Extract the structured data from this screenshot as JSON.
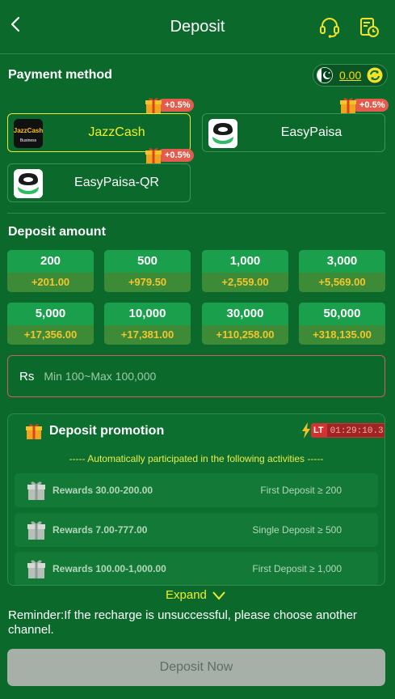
{
  "header": {
    "title": "Deposit",
    "back_icon": "chevron-left-icon",
    "support_icon": "headset-icon",
    "history_icon": "history-icon"
  },
  "payment": {
    "title": "Payment method",
    "balance": "0.00",
    "methods": [
      {
        "name": "JazzCash",
        "bonus": "+0.5%",
        "logo_text": "JazzCash",
        "logo_sub": "Business"
      },
      {
        "name": "EasyPaisa",
        "bonus": "+0.5%"
      },
      {
        "name": "EasyPaisa-QR",
        "bonus": "+0.5%"
      }
    ]
  },
  "deposit": {
    "title": "Deposit amount",
    "options": [
      {
        "amount": "200",
        "bonus": "+201.00"
      },
      {
        "amount": "500",
        "bonus": "+979.50"
      },
      {
        "amount": "1,000",
        "bonus": "+2,559.00"
      },
      {
        "amount": "3,000",
        "bonus": "+5,569.00"
      },
      {
        "amount": "5,000",
        "bonus": "+17,356.00"
      },
      {
        "amount": "10,000",
        "bonus": "+17,381.00"
      },
      {
        "amount": "30,000",
        "bonus": "+110,258.00"
      },
      {
        "amount": "50,000",
        "bonus": "+318,135.00"
      }
    ],
    "currency": "Rs",
    "placeholder": "Min 100~Max 100,000"
  },
  "promotion": {
    "title": "Deposit promotion",
    "badge": "LT",
    "timer": "01:29:10.3",
    "subtitle": "----- Automatically participated in the following activities -----",
    "rows": [
      {
        "reward": "Rewards 30.00-200.00",
        "condition": "First Deposit ≥ 200"
      },
      {
        "reward": "Rewards 7.00-777.00",
        "condition": "Single Deposit ≥ 500"
      },
      {
        "reward": "Rewards 100.00-1,000.00",
        "condition": "First Deposit ≥ 1,000"
      }
    ],
    "expand": "Expand"
  },
  "reminder": "Reminder:If the recharge is unsuccessful, please choose another channel.",
  "button": {
    "deposit": "Deposit Now"
  },
  "colors": {
    "background": "#0b6a2b",
    "accent": "#f0ee2e",
    "bonus": "#f6c52a",
    "badge": "#e35b4c"
  }
}
